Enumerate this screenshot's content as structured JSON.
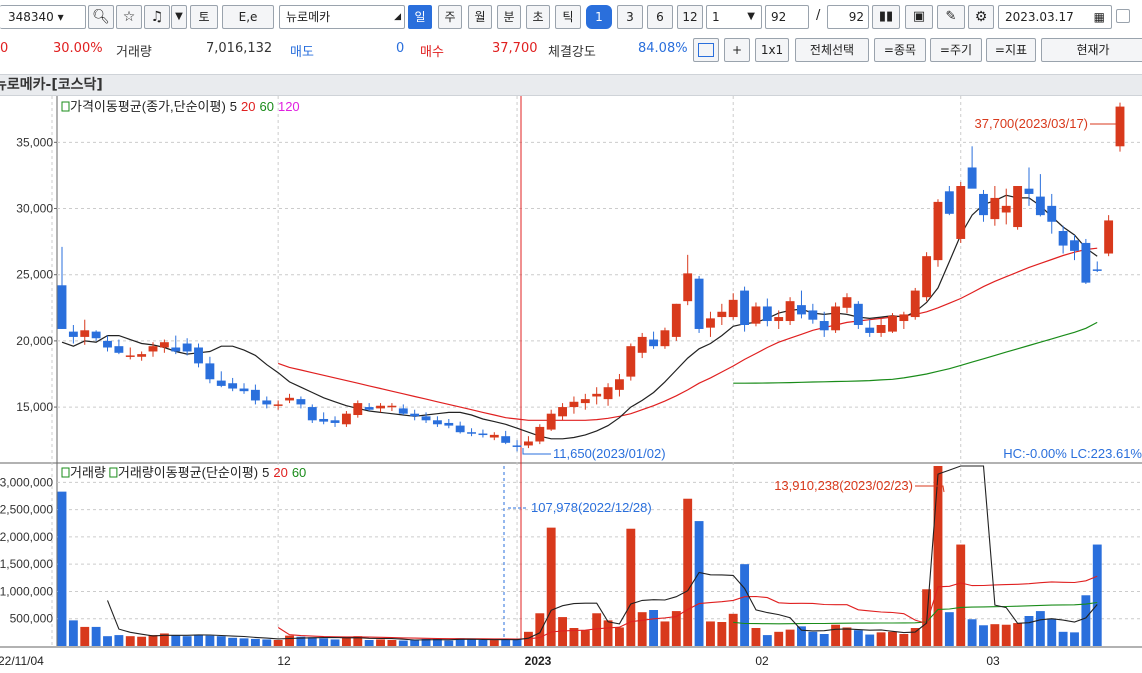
{
  "toolbar": {
    "code": "348340",
    "name": "뉴로메카",
    "to": "토",
    "ee": "E,e",
    "periods": [
      "일",
      "주",
      "월",
      "분",
      "초",
      "틱"
    ],
    "nums": [
      "1",
      "3",
      "6",
      "12"
    ],
    "interval": "1",
    "count": "92",
    "slash": "/",
    "total": "92",
    "date": "2023.03.17"
  },
  "info": {
    "v0": "0",
    "pct": "30.00%",
    "volume_label": "거래량",
    "volume": "7,016,132",
    "sell_label": "매도",
    "sell": "0",
    "buy_label": "매수",
    "buy": "37,700",
    "strength_label": "체결강도",
    "strength": "84.08%",
    "plus": "+",
    "one": "1x1",
    "select_all": "전체선택",
    "item": "=종목",
    "period": "=주기",
    "indicator": "=지표",
    "current": "현재가"
  },
  "chart_title": "뉴로메카-[코스닥]",
  "chart_data": {
    "type": "candlestick",
    "price_legend": {
      "label": "가격이동평균(종가,단순이평)",
      "periods": [
        "5",
        "20",
        "60",
        "120"
      ],
      "colors": [
        "#222222",
        "#e02020",
        "#1a8c1a",
        "#e020e0"
      ]
    },
    "volume_legend": {
      "label1": "거래량",
      "label2": "거래량이동평균(단순이평)",
      "periods": [
        "5",
        "20",
        "60"
      ],
      "colors": [
        "#222222",
        "#e02020",
        "#1a8c1a"
      ]
    },
    "y_ticks": [
      "35,000",
      "30,000",
      "25,000",
      "20,000",
      "15,000"
    ],
    "vol_ticks": [
      "3,000,000",
      "2,500,000",
      "2,000,000",
      "1,500,000",
      "1,000,000",
      "500,000"
    ],
    "x_labels": [
      "22/11/04",
      "12",
      "2023",
      "02",
      "03"
    ],
    "annotations": {
      "high": "37,700(2023/03/17)",
      "low": "11,650(2023/01/02)",
      "hclc": "HC:-0.00%  LC:223.61%",
      "vol_high": "13,910,238(2023/02/23)",
      "vol_low": "107,978(2022/12/28)"
    },
    "ylim": [
      10850,
      38500
    ],
    "vol_ylim": [
      0,
      3300000
    ],
    "ohlc": [
      [
        24200,
        27100,
        20900,
        20900
      ],
      [
        20700,
        21200,
        19800,
        20300
      ],
      [
        20300,
        21600,
        19700,
        20800
      ],
      [
        20700,
        20800,
        20000,
        20200
      ],
      [
        20000,
        20400,
        19200,
        19500
      ],
      [
        19600,
        20100,
        19000,
        19100
      ],
      [
        18900,
        19500,
        18600,
        18900
      ],
      [
        18800,
        19200,
        18500,
        19000
      ],
      [
        19200,
        19900,
        18800,
        19600
      ],
      [
        19500,
        20100,
        19100,
        19900
      ],
      [
        19500,
        20400,
        19000,
        19200
      ],
      [
        19800,
        20200,
        18900,
        19200
      ],
      [
        19500,
        19800,
        18000,
        18300
      ],
      [
        18300,
        18800,
        16800,
        17100
      ],
      [
        17000,
        17700,
        16500,
        16600
      ],
      [
        16800,
        17200,
        16200,
        16400
      ],
      [
        16400,
        16800,
        16000,
        16200
      ],
      [
        16300,
        16700,
        15200,
        15500
      ],
      [
        15500,
        15800,
        14900,
        15200
      ],
      [
        15100,
        15500,
        14800,
        15200
      ],
      [
        15500,
        16000,
        15300,
        15700
      ],
      [
        15600,
        15800,
        14900,
        15200
      ],
      [
        15000,
        15200,
        13800,
        14000
      ],
      [
        14100,
        14600,
        13700,
        13900
      ],
      [
        14000,
        14300,
        13500,
        13800
      ],
      [
        13700,
        14700,
        13500,
        14500
      ],
      [
        14400,
        15500,
        14200,
        15300
      ],
      [
        15000,
        15300,
        14700,
        14800
      ],
      [
        14900,
        15300,
        14600,
        15100
      ],
      [
        15000,
        15300,
        14700,
        15100
      ],
      [
        14900,
        15200,
        14400,
        14500
      ],
      [
        14500,
        14800,
        14000,
        14300
      ],
      [
        14300,
        14600,
        13800,
        14000
      ],
      [
        14000,
        14300,
        13500,
        13700
      ],
      [
        13800,
        14100,
        13400,
        13600
      ],
      [
        13600,
        13900,
        13000,
        13100
      ],
      [
        13100,
        13400,
        12800,
        13000
      ],
      [
        13000,
        13300,
        12700,
        12900
      ],
      [
        12700,
        13100,
        12500,
        12900
      ],
      [
        12800,
        13200,
        12200,
        12300
      ],
      [
        12100,
        12500,
        11650,
        12000
      ],
      [
        12100,
        12800,
        11900,
        12400
      ],
      [
        12400,
        13700,
        12200,
        13500
      ],
      [
        13300,
        14800,
        13200,
        14500
      ],
      [
        14300,
        15300,
        14000,
        15000
      ],
      [
        15000,
        15800,
        14500,
        15400
      ],
      [
        15300,
        16000,
        14800,
        15600
      ],
      [
        15800,
        16500,
        15200,
        16000
      ],
      [
        15600,
        16800,
        15100,
        16500
      ],
      [
        16300,
        17500,
        15800,
        17100
      ],
      [
        17300,
        19800,
        17000,
        19600
      ],
      [
        19100,
        20600,
        18700,
        20300
      ],
      [
        20100,
        20700,
        19400,
        19600
      ],
      [
        19600,
        21000,
        19400,
        20800
      ],
      [
        20300,
        22800,
        20000,
        22800
      ],
      [
        23000,
        26500,
        22700,
        25100
      ],
      [
        24700,
        24900,
        20600,
        20900
      ],
      [
        21000,
        22200,
        20300,
        21700
      ],
      [
        21800,
        22800,
        21200,
        22200
      ],
      [
        21800,
        23600,
        21600,
        23100
      ],
      [
        23800,
        24100,
        20700,
        21200
      ],
      [
        21300,
        22900,
        21100,
        22600
      ],
      [
        22600,
        23200,
        21100,
        21500
      ],
      [
        21500,
        22300,
        20900,
        21800
      ],
      [
        21500,
        23300,
        21200,
        23000
      ],
      [
        22700,
        23800,
        21700,
        22000
      ],
      [
        22300,
        22800,
        21300,
        21600
      ],
      [
        21500,
        22200,
        20300,
        20800
      ],
      [
        20800,
        22900,
        20600,
        22600
      ],
      [
        22500,
        23600,
        22100,
        23300
      ],
      [
        22800,
        23000,
        20900,
        21200
      ],
      [
        21000,
        21600,
        20300,
        20600
      ],
      [
        20600,
        21700,
        20300,
        21200
      ],
      [
        20700,
        22100,
        20600,
        21900
      ],
      [
        21500,
        22200,
        20900,
        22000
      ],
      [
        21800,
        24000,
        21600,
        23800
      ],
      [
        23300,
        26700,
        23000,
        26400
      ],
      [
        26100,
        30700,
        25600,
        30500
      ],
      [
        31300,
        31700,
        29500,
        29600
      ],
      [
        27700,
        32000,
        27400,
        31700
      ],
      [
        33100,
        34700,
        31600,
        31500
      ],
      [
        31100,
        31400,
        29000,
        29500
      ],
      [
        29200,
        31700,
        28700,
        30800
      ],
      [
        29700,
        31500,
        28800,
        30200
      ],
      [
        28600,
        31700,
        28400,
        31700
      ],
      [
        31500,
        33100,
        30200,
        31100
      ],
      [
        30900,
        32600,
        29400,
        29500
      ],
      [
        30200,
        31100,
        28100,
        29000
      ],
      [
        28300,
        28700,
        26600,
        27200
      ],
      [
        27600,
        28000,
        26100,
        26800
      ],
      [
        27400,
        27700,
        24300,
        24400
      ],
      [
        25400,
        26000,
        25200,
        25300
      ],
      [
        26600,
        29500,
        26400,
        29100
      ],
      [
        34700,
        38000,
        34300,
        37700
      ]
    ],
    "volumes": [
      2830000,
      470000,
      350000,
      350000,
      180000,
      200000,
      180000,
      170000,
      200000,
      230000,
      200000,
      180000,
      210000,
      190000,
      180000,
      150000,
      140000,
      130000,
      120000,
      110000,
      190000,
      170000,
      160000,
      140000,
      120000,
      160000,
      180000,
      110000,
      120000,
      110000,
      100000,
      110000,
      130000,
      130000,
      100000,
      140000,
      120000,
      110000,
      107978,
      110000,
      130000,
      260000,
      600000,
      2170000,
      530000,
      330000,
      290000,
      600000,
      470000,
      340000,
      2150000,
      620000,
      660000,
      450000,
      640000,
      2700000,
      2290000,
      450000,
      440000,
      590000,
      1500000,
      330000,
      200000,
      260000,
      300000,
      360000,
      260000,
      220000,
      390000,
      340000,
      290000,
      210000,
      250000,
      260000,
      220000,
      330000,
      1040000,
      13910238,
      620000,
      1860000,
      490000,
      380000,
      400000,
      390000,
      420000,
      550000,
      640000,
      500000,
      260000,
      250000,
      930000,
      1860000
    ],
    "ma_price": {
      "ma5": [
        19900,
        19600,
        20000,
        19900,
        20400,
        20400,
        20100,
        19800,
        19700,
        19500,
        19200,
        19000,
        19100,
        19200,
        19600,
        19600,
        19300,
        18900,
        18200,
        17600,
        16900,
        16500,
        16100,
        15700,
        15400,
        15100,
        14900,
        14700,
        14600,
        14500,
        14400,
        14300,
        14400,
        14500,
        14600,
        14600,
        14400,
        14100,
        13900,
        13700,
        13400,
        13100,
        12800,
        12600,
        12600,
        12700,
        12900,
        13200,
        13600,
        14200,
        15000,
        15500,
        16100,
        16900,
        17800,
        18700,
        19400,
        19800,
        20400,
        21100,
        21300,
        21400,
        21700,
        22100,
        22300,
        22400,
        22100,
        22000,
        22100,
        22000,
        21800,
        21700,
        21800,
        21900,
        21800,
        22200,
        22900,
        24000,
        26000,
        28000,
        29500,
        30300,
        30600,
        31000,
        30800,
        30800,
        30200,
        29400,
        28600,
        28000,
        27000,
        26400
      ],
      "ma20": [
        null,
        null,
        null,
        null,
        null,
        null,
        null,
        null,
        null,
        null,
        null,
        null,
        null,
        null,
        null,
        null,
        null,
        null,
        null,
        18300,
        18000,
        17800,
        17600,
        17400,
        17200,
        17000,
        16800,
        16600,
        16400,
        16200,
        16000,
        15800,
        15600,
        15400,
        15200,
        15000,
        14800,
        14600,
        14400,
        14200,
        14100,
        14000,
        14000,
        14000,
        14000,
        14000,
        14000,
        14050,
        14150,
        14300,
        14500,
        14800,
        15100,
        15450,
        15850,
        16300,
        16800,
        17200,
        17650,
        18100,
        18600,
        19050,
        19500,
        19900,
        20200,
        20500,
        20800,
        21000,
        21200,
        21400,
        21500,
        21600,
        21700,
        21800,
        21900,
        22000,
        22200,
        22500,
        22850,
        23200,
        23650,
        24100,
        24500,
        24850,
        25200,
        25550,
        25850,
        26150,
        26450,
        26700,
        26900,
        27000
      ],
      "ma60": [
        null,
        null,
        null,
        null,
        null,
        null,
        null,
        null,
        null,
        null,
        null,
        null,
        null,
        null,
        null,
        null,
        null,
        null,
        null,
        null,
        null,
        null,
        null,
        null,
        null,
        null,
        null,
        null,
        null,
        null,
        null,
        null,
        null,
        null,
        null,
        null,
        null,
        null,
        null,
        null,
        null,
        null,
        null,
        null,
        null,
        null,
        null,
        null,
        null,
        null,
        null,
        null,
        null,
        null,
        null,
        null,
        null,
        null,
        null,
        16800,
        16800,
        16810,
        16820,
        16830,
        16850,
        16870,
        16890,
        16910,
        16930,
        16950,
        16970,
        17000,
        17050,
        17100,
        17200,
        17350,
        17500,
        17700,
        17900,
        18150,
        18400,
        18650,
        18900,
        19150,
        19400,
        19650,
        19900,
        20150,
        20400,
        20650,
        20950,
        21400
      ]
    },
    "ma_vol": {
      "ma5": [
        null,
        null,
        null,
        null,
        null,
        null,
        null,
        null,
        null,
        null,
        null,
        null,
        null,
        null,
        null,
        null,
        null,
        null,
        null,
        null,
        null,
        null,
        null,
        null,
        null,
        null,
        null,
        null,
        null,
        null,
        null,
        null,
        null,
        null,
        null,
        null,
        null,
        null,
        null,
        null,
        null,
        null,
        null,
        null,
        null,
        null,
        null,
        null,
        null,
        null,
        null,
        null,
        null,
        null,
        null,
        null,
        null,
        null,
        null,
        null,
        null,
        null,
        null,
        null,
        null,
        null,
        null,
        null,
        null,
        null,
        null,
        null,
        null,
        null,
        null,
        null,
        null,
        null,
        null,
        null,
        null,
        null,
        null,
        null,
        null,
        null,
        null,
        null,
        null,
        null,
        null,
        null
      ]
    }
  }
}
